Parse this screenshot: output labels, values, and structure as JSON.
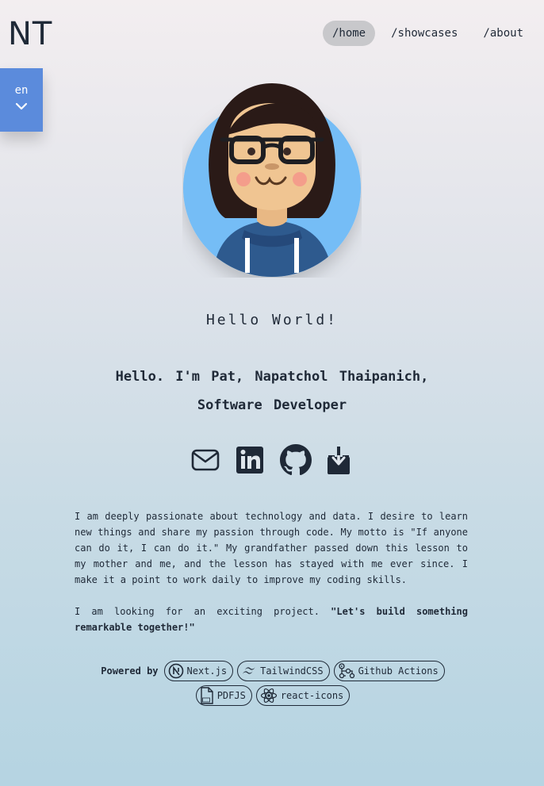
{
  "header": {
    "logo": "NT",
    "nav": [
      {
        "label": "/home",
        "active": true
      },
      {
        "label": "/showcases",
        "active": false
      },
      {
        "label": "/about",
        "active": false
      }
    ]
  },
  "language": {
    "current": "en",
    "icon": "chevron-down-icon"
  },
  "hero": {
    "avatar": "avatar-illustration",
    "greeting": "Hello World!",
    "intro_line1": "Hello. I'm Pat, Napatchol Thaipanich,",
    "intro_line2": "Software Developer"
  },
  "socials": [
    {
      "name": "email",
      "icon": "mail-icon"
    },
    {
      "name": "linkedin",
      "icon": "linkedin-icon"
    },
    {
      "name": "github",
      "icon": "github-icon"
    },
    {
      "name": "resume-download",
      "icon": "download-icon"
    }
  ],
  "bio": {
    "p1": "I am deeply passionate about technology and data. I desire to learn new things and share my passion through code. My motto is \"If anyone can do it, I can do it.\" My grandfather passed down this lesson to my mother and me, and the lesson has stayed with me ever since. I make it a point to work daily to improve my coding skills.",
    "p2_text": "I am looking for an exciting project. ",
    "p2_bold": "\"Let's build something remarkable together!\""
  },
  "powered_by": {
    "label": "Powered by",
    "items": [
      {
        "label": "Next.js",
        "icon": "nextjs-icon"
      },
      {
        "label": "TailwindCSS",
        "icon": "tailwind-icon"
      },
      {
        "label": "Github Actions",
        "icon": "github-actions-icon"
      },
      {
        "label": "PDFJS",
        "icon": "pdf-icon"
      },
      {
        "label": "react-icons",
        "icon": "react-icon"
      }
    ]
  },
  "colors": {
    "accent": "#5b8bdc",
    "text": "#1f2937",
    "nav_active": "#c8c8cb",
    "avatar_bg": "#74bdf6"
  }
}
